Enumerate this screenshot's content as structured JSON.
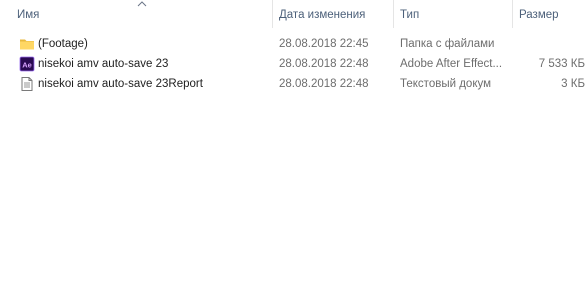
{
  "columns": {
    "name": "Имя",
    "date": "Дата изменения",
    "type": "Тип",
    "size": "Размер"
  },
  "sort": {
    "column": "name",
    "direction": "ascending",
    "icon": "sort-up-chevron-icon"
  },
  "files": [
    {
      "name": "(Footage)",
      "date": "28.08.2018 22:45",
      "type": "Папка с файлами",
      "size": "",
      "icon": "folder-icon"
    },
    {
      "name": "nisekoi amv auto-save 23",
      "date": "28.08.2018 22:48",
      "type": "Adobe After Effect...",
      "size": "7 533 КБ",
      "icon": "after-effects-icon"
    },
    {
      "name": "nisekoi amv auto-save 23Report",
      "date": "28.08.2018 22:48",
      "type": "Текстовый докум",
      "size": "3 КБ",
      "icon": "text-document-icon"
    }
  ],
  "colors": {
    "header_text": "#4c607a",
    "folder_yellow": "#ffd764",
    "ae_purple": "#2a0a52",
    "ae_text": "#d9a3ff"
  }
}
